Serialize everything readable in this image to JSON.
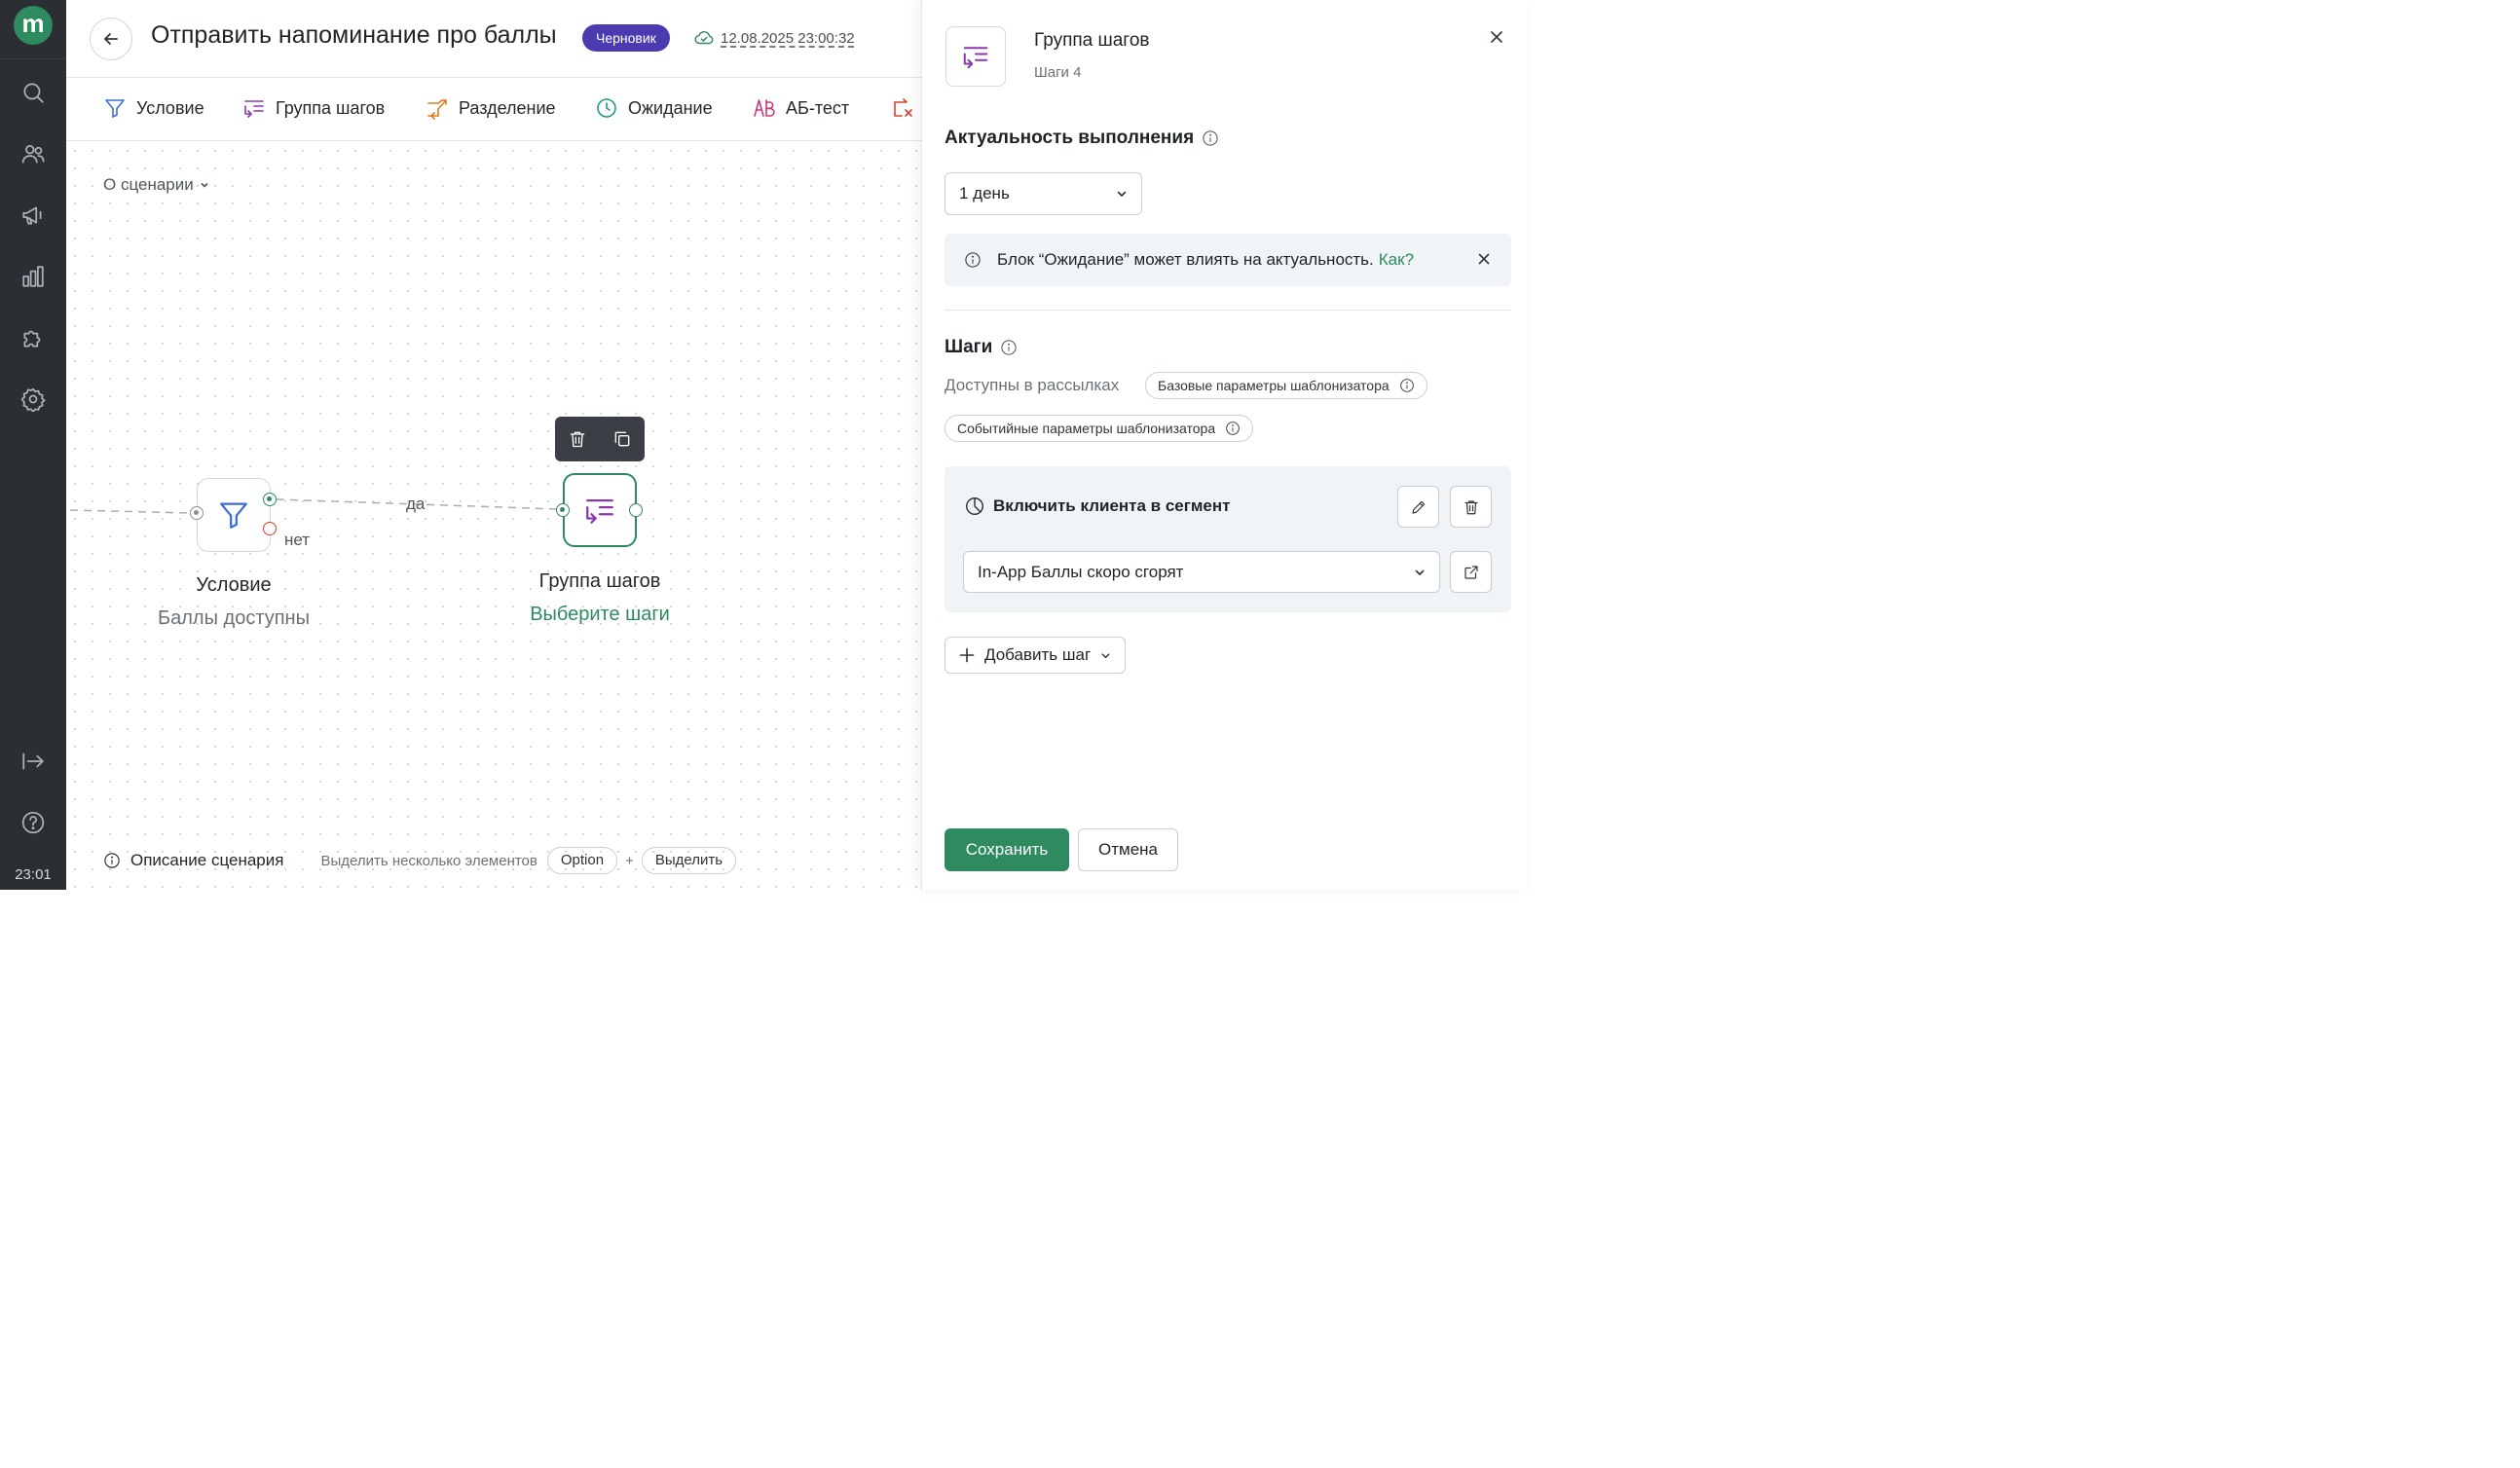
{
  "colors": {
    "nav_bg": "#2b2e33",
    "brand_green": "#2e8a5f",
    "draft_badge": "#4b3bb0",
    "condition_blue": "#3b6fd6",
    "group_purple": "#8a3aa8",
    "split_orange": "#e07b1a",
    "wait_teal": "#1f9a8a",
    "ab_pink": "#c93a7a",
    "error_red": "#d6402f"
  },
  "sidebar": {
    "logo": "m",
    "icons": [
      "search-icon",
      "users-icon",
      "megaphone-icon",
      "chart-icon",
      "puzzle-icon",
      "settings-icon",
      "collapse-icon",
      "help-icon"
    ],
    "clock": "23:01"
  },
  "header": {
    "title": "Отправить напоминание про баллы",
    "status_badge": "Черновик",
    "saved_at": "12.08.2025 23:00:32"
  },
  "toolbar": {
    "items": [
      {
        "label": "Условие",
        "icon": "filter-icon"
      },
      {
        "label": "Группа шагов",
        "icon": "steps-group-icon"
      },
      {
        "label": "Разделение",
        "icon": "split-icon"
      },
      {
        "label": "Ожидание",
        "icon": "clock-icon"
      },
      {
        "label": "АБ-тест",
        "icon": "ab-test-icon"
      },
      {
        "label": "",
        "icon": "exit-icon"
      }
    ]
  },
  "canvas": {
    "about_label": "О сценарии",
    "nodes": [
      {
        "title": "Условие",
        "subtitle": "Баллы доступны",
        "icon": "filter-icon"
      },
      {
        "title": "Группа шагов",
        "subtitle": "Выберите шаги",
        "icon": "steps-group-icon"
      }
    ],
    "edge_yes": "да",
    "edge_no": "нет",
    "float_actions": [
      "trash-icon",
      "copy-icon"
    ],
    "footer": {
      "description_label": "Описание сценария",
      "hint": "Выделить несколько элементов",
      "key1": "Option",
      "plus": "+",
      "key2": "Выделить"
    }
  },
  "panel": {
    "title": "Группа шагов",
    "subtitle": "Шаги 4",
    "relevance": {
      "heading": "Актуальность выполнения",
      "value": "1 день"
    },
    "alert": {
      "text": "Блок “Ожидание” может влиять на актуальность.",
      "link": "Как?"
    },
    "steps": {
      "heading": "Шаги",
      "available_label": "Доступны в рассылках",
      "chips": [
        "Базовые параметры шаблонизатора",
        "Событийные параметры шаблонизатора"
      ],
      "step": {
        "title": "Включить клиента в сегмент",
        "segment": "In-App Баллы скоро сгорят"
      },
      "add_label": "Добавить шаг"
    },
    "save_label": "Сохранить",
    "cancel_label": "Отмена"
  }
}
